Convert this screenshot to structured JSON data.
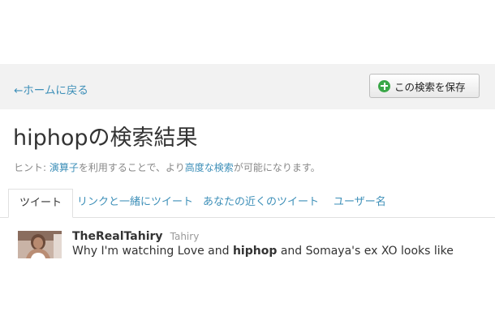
{
  "topbar": {
    "back_label": "←ホームに戻る",
    "save_label": "この検索を保存",
    "save_icon": "plus-circle-icon"
  },
  "search": {
    "title": "hiphopの検索結果",
    "hint": {
      "prefix": "ヒント: ",
      "link1": "演算子",
      "middle": "を利用することで、より",
      "link2": "高度な検索",
      "suffix": "が可能になります。"
    }
  },
  "tabs": [
    {
      "label": "ツイート",
      "active": true
    },
    {
      "label": "リンクと一緒にツイート",
      "active": false
    },
    {
      "label": "あなたの近くのツイート",
      "active": false
    },
    {
      "label": "ユーザー名",
      "active": false
    }
  ],
  "tweets": [
    {
      "screen_name": "TheRealTahiry",
      "name": "Tahiry",
      "text_before": "Why I'm watching Love and ",
      "text_keyword": "hiphop",
      "text_after": " and Somaya's ex XO looks like"
    }
  ],
  "colors": {
    "link": "#3d8fb8",
    "topbar_bg": "#f2f2f2",
    "save_icon_green": "#3aa748"
  }
}
